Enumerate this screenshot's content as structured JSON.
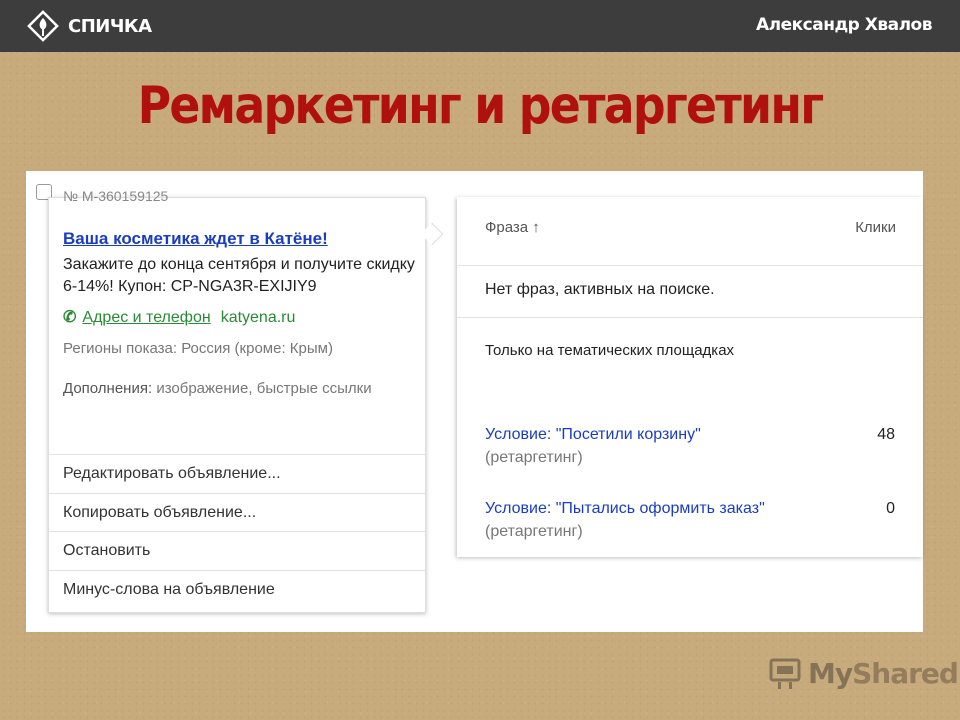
{
  "header": {
    "brand": "СПИЧКА",
    "author": "Александр Хвалов",
    "brand_icon": "spichka-logo-icon"
  },
  "slide": {
    "title": "Ремаркетинг и ретаргетинг"
  },
  "ad": {
    "number": "№ M-360159125",
    "title": "Ваша косметика ждет в Катёне!",
    "text": "Закажите до конца сентября и получите скидку 6-14%! Купон: CP-NGA3R-EXIJIY9",
    "phone_icon": "✆",
    "contacts_link": "Адрес и телефон",
    "domain": "katyena.ru",
    "regions": "Регионы показа: Россия (кроме: Крым)",
    "extras_label": "Дополнения:",
    "extras_value": "изображение, быстрые ссылки",
    "actions": [
      "Редактировать объявление...",
      "Копировать объявление...",
      "Остановить",
      "Минус-слова на объявление"
    ]
  },
  "phrases": {
    "col_phrase": "Фраза ↑",
    "col_clicks": "Клики",
    "empty_text": "Нет фраз, активных на поиске.",
    "subhead": "Только на тематических площадках",
    "rows": [
      {
        "name": "Условие: \"Посетили корзину\"",
        "type": "(ретаргетинг)",
        "clicks": "48"
      },
      {
        "name": "Условие: \"Пытались оформить заказ\"",
        "type": "(ретаргетинг)",
        "clicks": "0"
      }
    ]
  },
  "watermark": {
    "text_my": "My",
    "text_shared": "Shared",
    "icon": "myshared-logo-icon"
  },
  "colors": {
    "topbar": "#3d3d3d",
    "title_red": "#b0110f",
    "link_blue": "#1a3dbf",
    "link_green": "#2a8a35",
    "background": "#c8ab7c"
  }
}
